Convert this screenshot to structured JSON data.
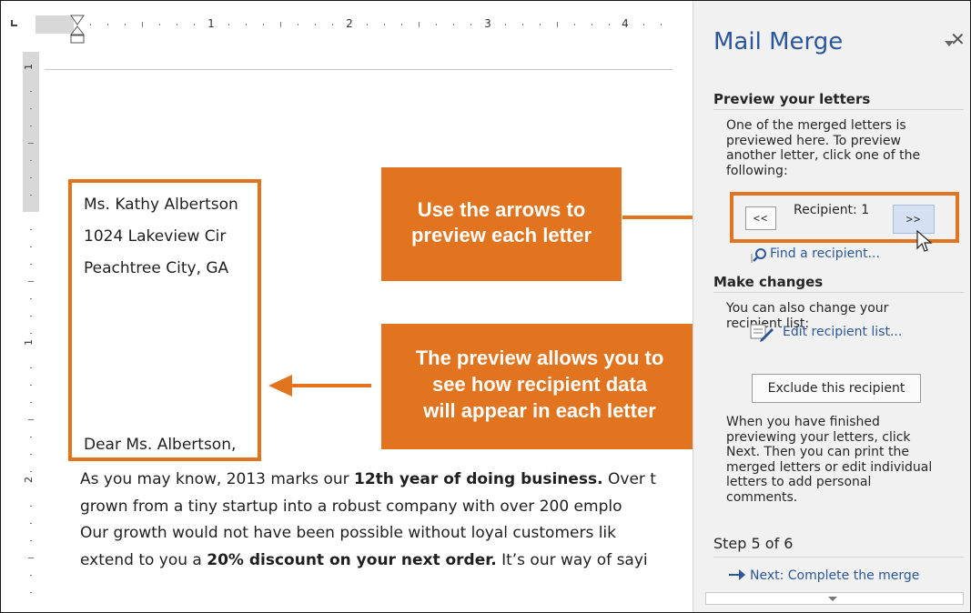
{
  "document": {
    "ruler_numbers": [
      "1",
      "2",
      "3",
      "4"
    ],
    "vruler_numbers": [
      "1",
      "1",
      "2"
    ],
    "address": {
      "name": "Ms. Kathy Albertson",
      "street": "1024 Lakeview Cir",
      "city": "Peachtree City, GA"
    },
    "greeting": "Dear Ms. Albertson,",
    "body": {
      "line1_pre": "As you may know, 2013 marks our ",
      "line1_bold": "12th year of doing business.",
      "line1_post": " Over t",
      "line2": "grown from a tiny startup into a robust company with over 200 emplo",
      "line3": "Our growth would not have been possible without loyal customers lik",
      "line4_pre": "extend to you a ",
      "line4_bold": "20% discount on your next order.",
      "line4_post": " It’s our way of sayi"
    }
  },
  "callouts": {
    "arrows": {
      "line1": "Use the arrows to",
      "line2": "preview each letter"
    },
    "preview": {
      "line1": "The preview allows you to",
      "line2": "see how recipient data",
      "line3": "will appear in each letter"
    }
  },
  "pane": {
    "title": "Mail Merge",
    "preview": {
      "heading": "Preview your letters",
      "description": "One of the merged letters is previewed here. To preview another letter, click one of the following:",
      "prev_label": "<<",
      "recipient_label": "Recipient: 1",
      "next_label": ">>",
      "find_link": "Find a recipient..."
    },
    "changes": {
      "heading": "Make changes",
      "description": "You can also change your recipient list:",
      "edit_link": "Edit recipient list...",
      "exclude_label": "Exclude this recipient",
      "finished_text": "When you have finished previewing your letters, click Next. Then you can print the merged letters or edit individual letters to add personal comments."
    },
    "step": {
      "label": "Step 5 of 6",
      "next_link": "Next: Complete the merge"
    }
  },
  "colors": {
    "accent": "#e2731f",
    "link": "#2b579a"
  },
  "icons": {
    "find": "magnifier-icon",
    "edit": "edit-list-icon",
    "next": "arrow-right-icon",
    "close": "close-icon",
    "menu": "chevron-down-icon"
  }
}
